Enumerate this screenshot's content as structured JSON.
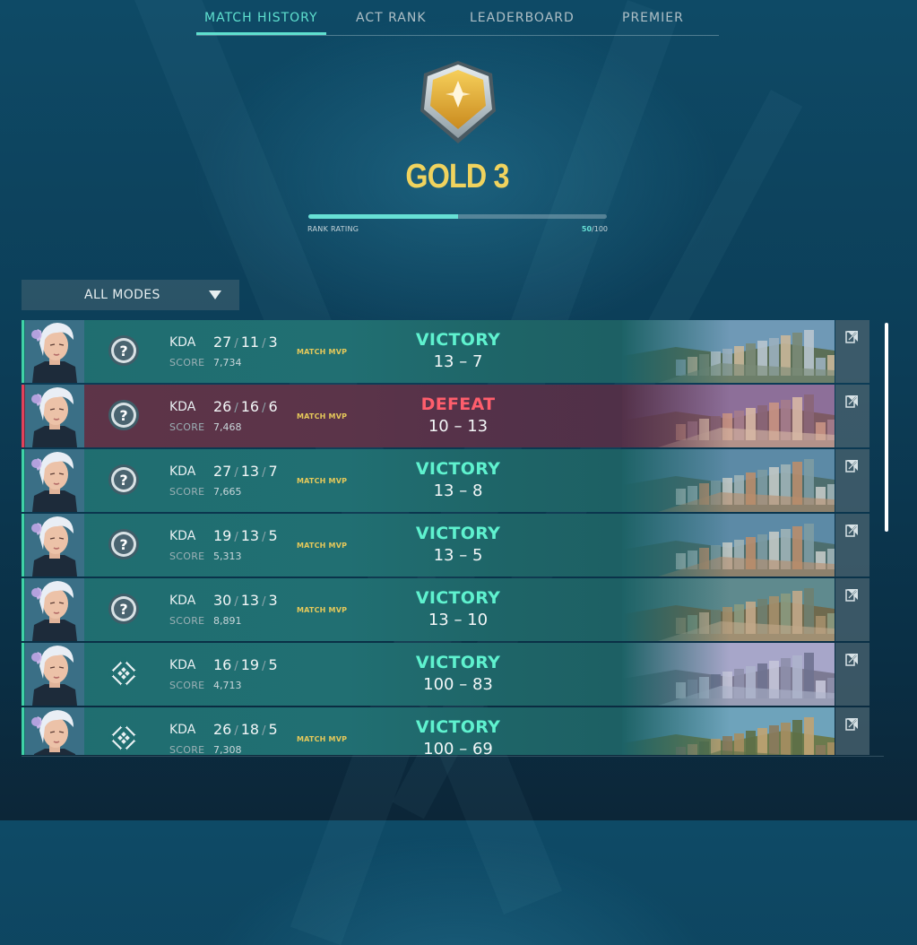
{
  "tabs": [
    {
      "label": "MATCH HISTORY",
      "active": true
    },
    {
      "label": "ACT RANK",
      "active": false
    },
    {
      "label": "LEADERBOARD",
      "active": false
    },
    {
      "label": "PREMIER",
      "active": false
    }
  ],
  "rank": {
    "name": "GOLD 3",
    "rating_label": "RANK RATING",
    "rating_current": "50",
    "rating_max": "/100",
    "rating_progress": 0.5,
    "icon": "gold-rank-shield-icon",
    "color": "#f0d35e"
  },
  "filter": {
    "selected": "ALL MODES",
    "icon": "chevron-down-icon"
  },
  "colors": {
    "accent": "#5fe0cf",
    "victory": "#5ff2cf",
    "defeat": "#ff5e6c",
    "mvp": "#e6c95a"
  },
  "matches": [
    {
      "outcome": "win",
      "mode_icon": "unrated-mode-icon",
      "kda_label": "KDA",
      "kills": "27",
      "deaths": "11",
      "assists": "3",
      "score_label": "SCORE",
      "score": "7,734",
      "mvp": "MATCH MVP",
      "result": "VICTORY",
      "team_score": "13",
      "dash": "–",
      "enemy_score": "7",
      "map": "map-1"
    },
    {
      "outcome": "loss",
      "mode_icon": "unrated-mode-icon",
      "kda_label": "KDA",
      "kills": "26",
      "deaths": "16",
      "assists": "6",
      "score_label": "SCORE",
      "score": "7,468",
      "mvp": "MATCH MVP",
      "result": "DEFEAT",
      "team_score": "10",
      "dash": "–",
      "enemy_score": "13",
      "map": "map-2"
    },
    {
      "outcome": "win",
      "mode_icon": "unrated-mode-icon",
      "kda_label": "KDA",
      "kills": "27",
      "deaths": "13",
      "assists": "7",
      "score_label": "SCORE",
      "score": "7,665",
      "mvp": "MATCH MVP",
      "result": "VICTORY",
      "team_score": "13",
      "dash": "–",
      "enemy_score": "8",
      "map": "map-3"
    },
    {
      "outcome": "win",
      "mode_icon": "unrated-mode-icon",
      "kda_label": "KDA",
      "kills": "19",
      "deaths": "13",
      "assists": "5",
      "score_label": "SCORE",
      "score": "5,313",
      "mvp": "MATCH MVP",
      "result": "VICTORY",
      "team_score": "13",
      "dash": "–",
      "enemy_score": "5",
      "map": "map-3"
    },
    {
      "outcome": "win",
      "mode_icon": "unrated-mode-icon",
      "kda_label": "KDA",
      "kills": "30",
      "deaths": "13",
      "assists": "3",
      "score_label": "SCORE",
      "score": "8,891",
      "mvp": "MATCH MVP",
      "result": "VICTORY",
      "team_score": "13",
      "dash": "–",
      "enemy_score": "10",
      "map": "map-4"
    },
    {
      "outcome": "win",
      "mode_icon": "deathmatch-mode-icon",
      "kda_label": "KDA",
      "kills": "16",
      "deaths": "19",
      "assists": "5",
      "score_label": "SCORE",
      "score": "4,713",
      "mvp": "",
      "result": "VICTORY",
      "team_score": "100",
      "dash": "–",
      "enemy_score": "83",
      "map": "map-5"
    },
    {
      "outcome": "win",
      "mode_icon": "deathmatch-mode-icon",
      "kda_label": "KDA",
      "kills": "26",
      "deaths": "18",
      "assists": "5",
      "score_label": "SCORE",
      "score": "7,308",
      "mvp": "MATCH MVP",
      "result": "VICTORY",
      "team_score": "100",
      "dash": "–",
      "enemy_score": "69",
      "map": "map-6"
    }
  ]
}
